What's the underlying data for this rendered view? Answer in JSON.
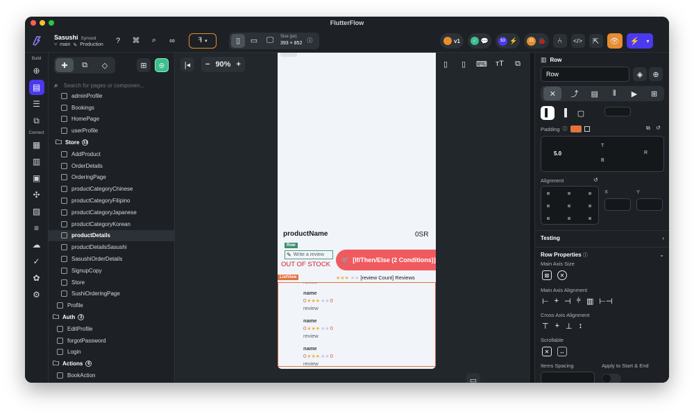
{
  "window": {
    "title": "FlutterFlow"
  },
  "project": {
    "name": "Sasushi",
    "sync_status": "Synced",
    "branch": "main",
    "environment": "Production"
  },
  "device": {
    "size_label": "Size (px)",
    "size_value": "393 × 852"
  },
  "toolbar": {
    "version_badge": "v1",
    "issues_count": "53",
    "warnings_count": "21"
  },
  "rail": {
    "build_label": "Build",
    "connect_label": "Connect"
  },
  "search": {
    "placeholder": "Search for pages or componen..."
  },
  "tree": {
    "pages": [
      "adminProfile",
      "Bookings",
      "HomePage",
      "userProfile"
    ],
    "store_folder": {
      "label": "Store",
      "count": "13"
    },
    "store_pages": [
      "AddProduct",
      "OrderDetails",
      "OrderingPage",
      "productCategoryChinese",
      "productCategoryFilipino",
      "productCategoryJapanese",
      "productCategoryKorean",
      "productDetails",
      "productDetailsSasushi",
      "SasushiOrderDetails",
      "SignupCopy",
      "Store",
      "SushiOrderingPage"
    ],
    "selected_page": "productDetails",
    "profile_page": "Profile",
    "auth_folder": {
      "label": "Auth",
      "count": "3"
    },
    "auth_pages": [
      "EditProfile",
      "forgotPassword",
      "Login"
    ],
    "actions_folder": {
      "label": "Actions",
      "count": "6"
    },
    "action_items": [
      "BookAction"
    ]
  },
  "zoom": {
    "value": "90%",
    "minus": "−",
    "plus": "+"
  },
  "preview": {
    "product_name": "productName",
    "price": "0SR",
    "row_tag": "Row",
    "write_review": "Write a review",
    "out_of_stock": "OUT OF STOCK",
    "cart_button": "[If/Then/Else (2 Conditions)]",
    "listview_tag": "ListView",
    "review_count": "[review Count] Reviews",
    "top_review_label": "review",
    "reviews": [
      {
        "name": "name",
        "score_left": "0",
        "score_right": "0",
        "label": "review"
      },
      {
        "name": "name",
        "score_left": "0",
        "score_right": "0",
        "label": "review"
      },
      {
        "name": "name",
        "score_left": "0",
        "score_right": "0",
        "label": "review"
      }
    ]
  },
  "props": {
    "widget_type": "Row",
    "widget_name": "Row",
    "padding_label": "Padding",
    "padding_value": "5.0",
    "pad_top": "T",
    "pad_bottom": "B",
    "pad_right": "R",
    "alignment_label": "Alignment",
    "x_label": "X",
    "y_label": "Y",
    "testing_label": "Testing",
    "row_props_label": "Row Properties",
    "main_axis_size_label": "Main Axis Size",
    "main_axis_alignment_label": "Main Axis Alignment",
    "cross_axis_alignment_label": "Cross Axis Alignment",
    "scrollable_label": "Scrollable",
    "items_spacing_label": "Items Spacing",
    "apply_start_end_label": "Apply to Start & End"
  },
  "colors": {
    "accent": "#4b39ef",
    "danger": "#e5484d",
    "sale_red": "#d11a2a",
    "stars": "#e8b13c",
    "panel": "#1d2125"
  }
}
